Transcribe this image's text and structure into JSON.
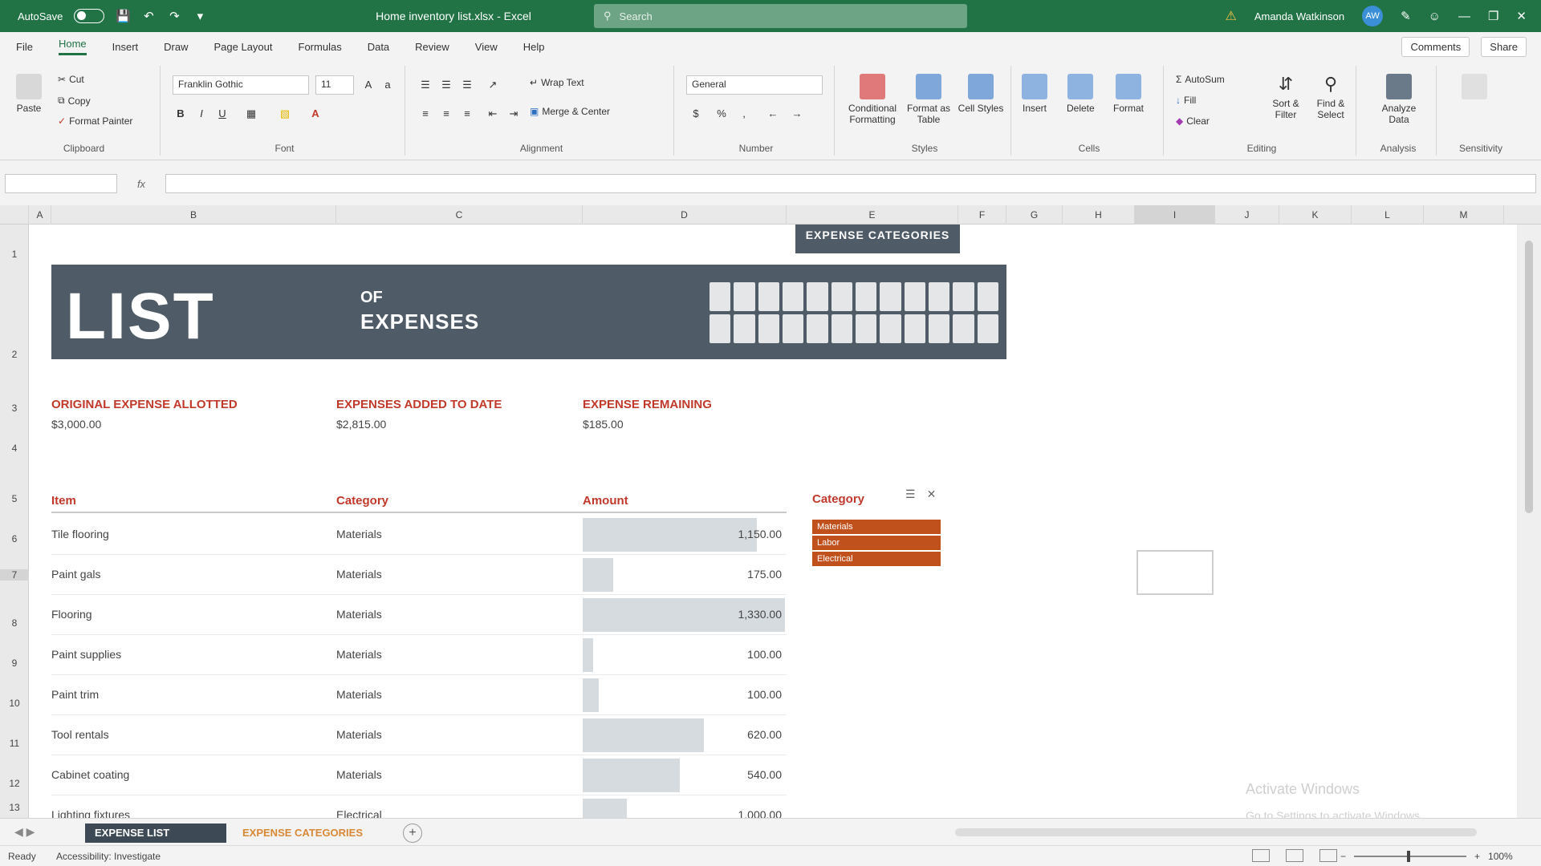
{
  "titlebar": {
    "autosave": "AutoSave",
    "autosave_state": "Off",
    "doc_title": "Home inventory list.xlsx - Excel",
    "search_placeholder": "Search",
    "user": "Amanda Watkinson",
    "avatar": "AW"
  },
  "ribbon_tabs": [
    "File",
    "Home",
    "Insert",
    "Draw",
    "Page Layout",
    "Formulas",
    "Data",
    "Review",
    "View",
    "Help"
  ],
  "ribbon_right": {
    "comments": "Comments",
    "share": "Share"
  },
  "ribbon": {
    "clipboard": {
      "paste": "Paste",
      "cut": "Cut",
      "copy": "Copy",
      "format_painter": "Format Painter",
      "label": "Clipboard"
    },
    "font": {
      "name": "Franklin Gothic",
      "size": "11",
      "label": "Font"
    },
    "alignment": {
      "wrap": "Wrap Text",
      "merge": "Merge & Center",
      "label": "Alignment"
    },
    "number": {
      "format": "General",
      "label": "Number"
    },
    "styles": {
      "conditional": "Conditional Formatting",
      "format_table": "Format as Table",
      "cell_styles": "Cell Styles",
      "label": "Styles"
    },
    "cells": {
      "insert": "Insert",
      "delete": "Delete",
      "format": "Format",
      "label": "Cells"
    },
    "editing": {
      "autosum": "AutoSum",
      "fill": "Fill",
      "clear": "Clear",
      "sort": "Sort & Filter",
      "find": "Find & Select",
      "label": "Editing"
    },
    "analysis": {
      "analyze": "Analyze Data",
      "label": "Analysis"
    },
    "sensitivity": {
      "label": "Sensitivity"
    }
  },
  "formula_bar": {
    "name_box": "",
    "fx": "fx"
  },
  "columns": [
    "A",
    "B",
    "C",
    "D",
    "E",
    "F",
    "G",
    "H",
    "I",
    "J",
    "K",
    "L",
    "M"
  ],
  "rows": [
    "1",
    "2",
    "3",
    "4",
    "5",
    "6",
    "7",
    "8",
    "9",
    "10",
    "11",
    "12",
    "13"
  ],
  "banner": {
    "big": "LIST",
    "of": "OF",
    "sub": "EXPENSES",
    "tag": "EXPENSE CATEGORIES"
  },
  "kpis": [
    {
      "label": "ORIGINAL EXPENSE ALLOTTED",
      "value": "$3,000.00"
    },
    {
      "label": "EXPENSES ADDED TO DATE",
      "value": "$2,815.00"
    },
    {
      "label": "EXPENSE REMAINING",
      "value": "$185.00"
    }
  ],
  "table": {
    "headers": [
      "Item",
      "Category",
      "Amount"
    ],
    "rows": [
      {
        "item": "Tile flooring",
        "category": "Materials",
        "amount": "1,150.00",
        "fill": 0.86
      },
      {
        "item": "Paint gals",
        "category": "Materials",
        "amount": "175.00",
        "fill": 0.15
      },
      {
        "item": "Flooring",
        "category": "Materials",
        "amount": "1,330.00",
        "fill": 1.0
      },
      {
        "item": "Paint supplies",
        "category": "Materials",
        "amount": "100.00",
        "fill": 0.05
      },
      {
        "item": "Paint trim",
        "category": "Materials",
        "amount": "100.00",
        "fill": 0.08
      },
      {
        "item": "Tool rentals",
        "category": "Materials",
        "amount": "620.00",
        "fill": 0.6
      },
      {
        "item": "Cabinet coating",
        "category": "Materials",
        "amount": "540.00",
        "fill": 0.48
      },
      {
        "item": "Lighting fixtures",
        "category": "Electrical",
        "amount": "1,000.00",
        "fill": 0.22
      }
    ]
  },
  "slicer": {
    "title": "Category",
    "items": [
      "Materials",
      "Labor",
      "Electrical"
    ]
  },
  "watermark": {
    "line1": "Activate Windows",
    "line2": "Go to Settings to activate Windows."
  },
  "sheets": {
    "active": "EXPENSE LIST",
    "other": "EXPENSE CATEGORIES"
  },
  "status": {
    "ready": "Ready",
    "accessibility": "Accessibility: Investigate",
    "zoom": "100%"
  },
  "colors": {
    "excel_green": "#217346",
    "banner": "#4f5b66",
    "accent_red": "#c0392b",
    "slicer_orange": "#c0501c"
  }
}
